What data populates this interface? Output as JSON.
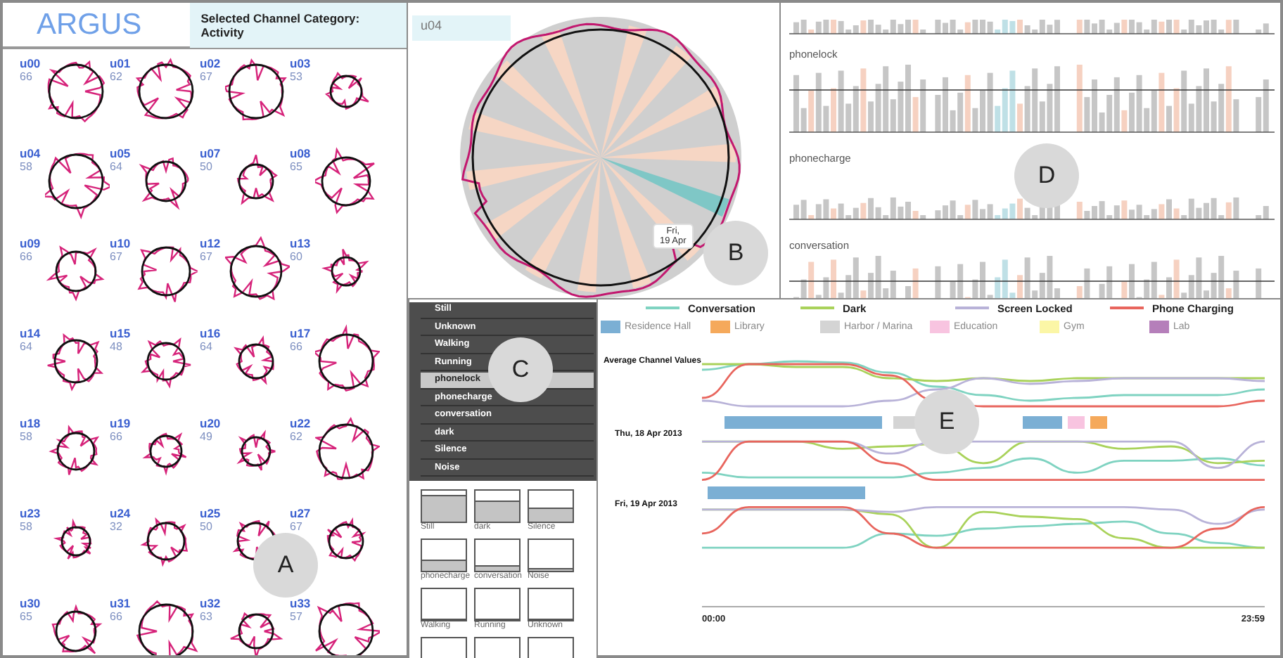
{
  "users_panel": {
    "title": "ARGUS",
    "category_badge": "Selected Channel Category: Activity",
    "users": [
      {
        "id": "u00",
        "count": "66"
      },
      {
        "id": "u01",
        "count": "62"
      },
      {
        "id": "u02",
        "count": "67"
      },
      {
        "id": "u03",
        "count": "53"
      },
      {
        "id": "u04",
        "count": "58"
      },
      {
        "id": "u05",
        "count": "64"
      },
      {
        "id": "u07",
        "count": "50"
      },
      {
        "id": "u08",
        "count": "65"
      },
      {
        "id": "u09",
        "count": "66"
      },
      {
        "id": "u10",
        "count": "67"
      },
      {
        "id": "u12",
        "count": "67"
      },
      {
        "id": "u13",
        "count": "60"
      },
      {
        "id": "u14",
        "count": "64"
      },
      {
        "id": "u15",
        "count": "48"
      },
      {
        "id": "u16",
        "count": "64"
      },
      {
        "id": "u17",
        "count": "66"
      },
      {
        "id": "u18",
        "count": "58"
      },
      {
        "id": "u19",
        "count": "66"
      },
      {
        "id": "u20",
        "count": "49"
      },
      {
        "id": "u22",
        "count": "62"
      },
      {
        "id": "u23",
        "count": "58"
      },
      {
        "id": "u24",
        "count": "32"
      },
      {
        "id": "u25",
        "count": "50"
      },
      {
        "id": "u27",
        "count": "67"
      },
      {
        "id": "u30",
        "count": "65"
      },
      {
        "id": "u31",
        "count": "66"
      },
      {
        "id": "u32",
        "count": "63"
      },
      {
        "id": "u33",
        "count": "57"
      }
    ]
  },
  "detail_panel": {
    "user": "u04",
    "tooltip": [
      "Fri,",
      "19 Apr"
    ]
  },
  "channel_bars": {
    "rows": [
      {
        "label": "phonelock"
      },
      {
        "label": "phonecharge"
      },
      {
        "label": "conversation"
      }
    ]
  },
  "channel_menu": {
    "items": [
      {
        "label": "Still",
        "selected": false
      },
      {
        "label": "Unknown",
        "selected": false
      },
      {
        "label": "Walking",
        "selected": false
      },
      {
        "label": "Running",
        "selected": false
      },
      {
        "label": "phonelock",
        "selected": true
      },
      {
        "label": "phonecharge",
        "selected": false
      },
      {
        "label": "conversation",
        "selected": false
      },
      {
        "label": "dark",
        "selected": false
      },
      {
        "label": "Silence",
        "selected": false
      },
      {
        "label": "Noise",
        "selected": false
      }
    ]
  },
  "channel_thumbnails": [
    {
      "label": "Still"
    },
    {
      "label": "dark"
    },
    {
      "label": "Silence"
    },
    {
      "label": "phonecharge"
    },
    {
      "label": "conversation"
    },
    {
      "label": "Noise"
    },
    {
      "label": "Walking"
    },
    {
      "label": "Running"
    },
    {
      "label": "Unknown"
    }
  ],
  "timeline": {
    "line_legend": [
      {
        "label": "Conversation",
        "color": "#7fd3c1"
      },
      {
        "label": "Dark",
        "color": "#a9d25a"
      },
      {
        "label": "Screen Locked",
        "color": "#b8b2d8"
      },
      {
        "label": "Phone Charging",
        "color": "#e8655d"
      }
    ],
    "location_legend": [
      {
        "label": "Residence Hall",
        "color": "#7bafd4"
      },
      {
        "label": "Library",
        "color": "#f5a95b"
      },
      {
        "label": "Harbor / Marina",
        "color": "#d4d4d4"
      },
      {
        "label": "Education",
        "color": "#f8c4e0"
      },
      {
        "label": "Gym",
        "color": "#fbf6a6"
      },
      {
        "label": "Lab",
        "color": "#b57fba"
      }
    ],
    "rows": [
      {
        "label": "Average Channel Values"
      },
      {
        "label": "Thu, 18 Apr 2013"
      },
      {
        "label": "Fri, 19 Apr 2013"
      }
    ],
    "axis": {
      "start": "00:00",
      "end": "23:59"
    }
  },
  "callouts": [
    {
      "label": "A"
    },
    {
      "label": "B"
    },
    {
      "label": "C"
    },
    {
      "label": "D"
    },
    {
      "label": "E"
    }
  ]
}
